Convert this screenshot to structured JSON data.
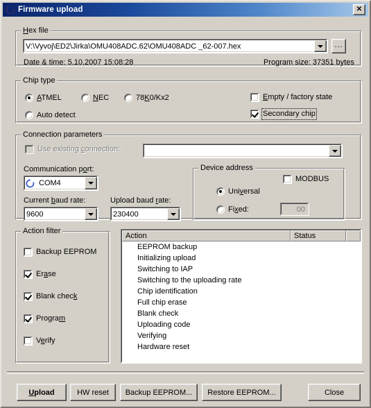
{
  "window": {
    "title": "Firmware upload",
    "icon": "progress-ring-icon",
    "close_label": "✕"
  },
  "hex_file": {
    "group_title": "Hex file",
    "path": "V:\\Vyvoj\\ED2\\Jirka\\OMU408ADC.62\\OMU408ADC  _62-007.hex",
    "browse_label": "...",
    "date_time": "Date & time: 5.10.2007 15:08:28",
    "program_size": "Program size: 37351 bytes"
  },
  "chip_type": {
    "group_title": "Chip type",
    "options": [
      {
        "label": "ATMEL",
        "selected": true
      },
      {
        "label": "NEC",
        "selected": false
      },
      {
        "label": "78K0/Kx2",
        "selected": false
      },
      {
        "label": "Auto detect",
        "selected": false
      }
    ],
    "checks": [
      {
        "label": "Empty / factory state",
        "checked": false,
        "focused": false
      },
      {
        "label": "Secondary chip",
        "checked": true,
        "focused": true
      }
    ]
  },
  "connection": {
    "group_title": "Connection parameters",
    "use_existing_label": "Use existing connection:",
    "use_existing_checked": false,
    "use_existing_disabled": true,
    "existing_connection_value": "",
    "com_port_label": "Communication port:",
    "com_port_value": "COM4",
    "com_port_icon": "refresh-circle-icon",
    "current_baud_label": "Current baud rate:",
    "current_baud_value": "9600",
    "upload_baud_label": "Upload baud rate:",
    "upload_baud_value": "230400",
    "device_address": {
      "group_title": "Device address",
      "modbus_label": "MODBUS",
      "modbus_checked": false,
      "universal_label": "Universal",
      "universal_selected": true,
      "fixed_label": "Fixed:",
      "fixed_selected": false,
      "fixed_value": "00"
    }
  },
  "action_filter": {
    "group_title": "Action filter",
    "items": [
      {
        "label": "Backup EEPROM",
        "checked": false
      },
      {
        "label": "Erase",
        "checked": true
      },
      {
        "label": "Blank check",
        "checked": true
      },
      {
        "label": "Program",
        "checked": true
      },
      {
        "label": "Verify",
        "checked": false
      }
    ]
  },
  "action_list": {
    "columns": [
      "Action",
      "Status",
      ""
    ],
    "rows": [
      {
        "action": "EEPROM backup",
        "status": ""
      },
      {
        "action": "Initializing upload",
        "status": ""
      },
      {
        "action": "Switching to IAP",
        "status": ""
      },
      {
        "action": "Switching to the uploading rate",
        "status": ""
      },
      {
        "action": "Chip identification",
        "status": ""
      },
      {
        "action": "Full chip erase",
        "status": ""
      },
      {
        "action": "Blank check",
        "status": ""
      },
      {
        "action": "Uploading code",
        "status": ""
      },
      {
        "action": "Verifying",
        "status": ""
      },
      {
        "action": "Hardware reset",
        "status": ""
      }
    ]
  },
  "footer": {
    "buttons": [
      {
        "label": "Upload",
        "default": true
      },
      {
        "label": "HW reset",
        "default": false
      },
      {
        "label": "Backup EEPROM...",
        "default": false
      },
      {
        "label": "Restore EEPROM...",
        "default": false
      },
      {
        "label": "Close",
        "default": false
      }
    ]
  },
  "colors": {
    "face": "#d4d0c8",
    "title_left": "#0a246a",
    "title_right": "#a6c8ea",
    "field": "#ffffff",
    "disabled_text": "#808080"
  }
}
